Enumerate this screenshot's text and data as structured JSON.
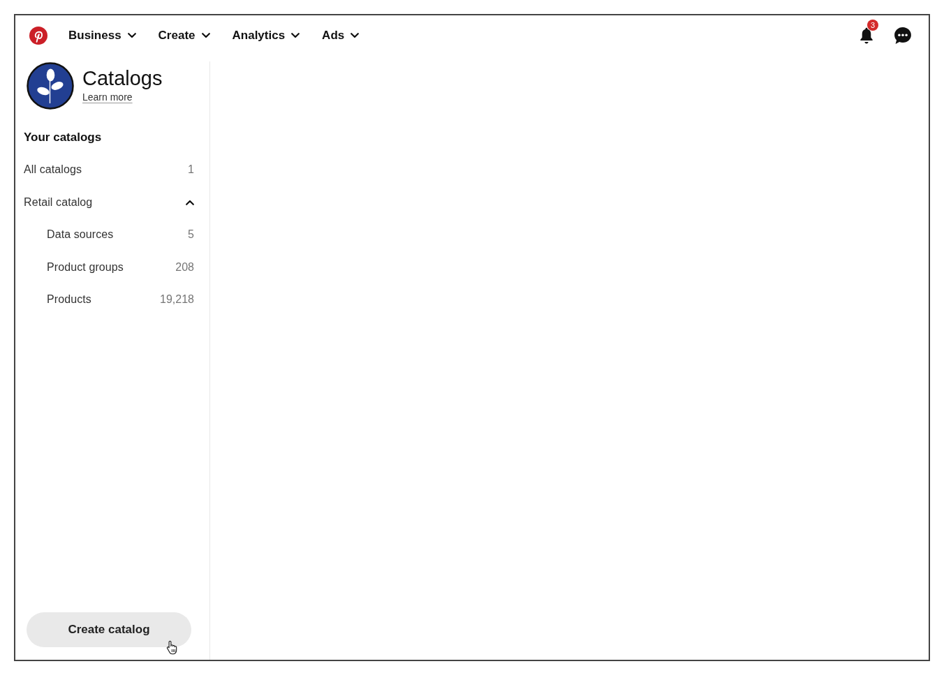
{
  "nav": {
    "items": [
      {
        "label": "Business"
      },
      {
        "label": "Create"
      },
      {
        "label": "Analytics"
      },
      {
        "label": "Ads"
      }
    ]
  },
  "notifications": {
    "count": "3"
  },
  "catalogs_header": {
    "title": "Catalogs",
    "link": "Learn more"
  },
  "sidebar": {
    "heading": "Your catalogs",
    "items": [
      {
        "label": "All catalogs",
        "count": "1"
      },
      {
        "label": "Retail catalog",
        "expanded": true,
        "children": [
          {
            "label": "Data sources",
            "count": "5"
          },
          {
            "label": "Product groups",
            "count": "208"
          },
          {
            "label": "Products",
            "count": "19,218"
          }
        ]
      }
    ]
  },
  "create_button": {
    "label": "Create catalog"
  }
}
